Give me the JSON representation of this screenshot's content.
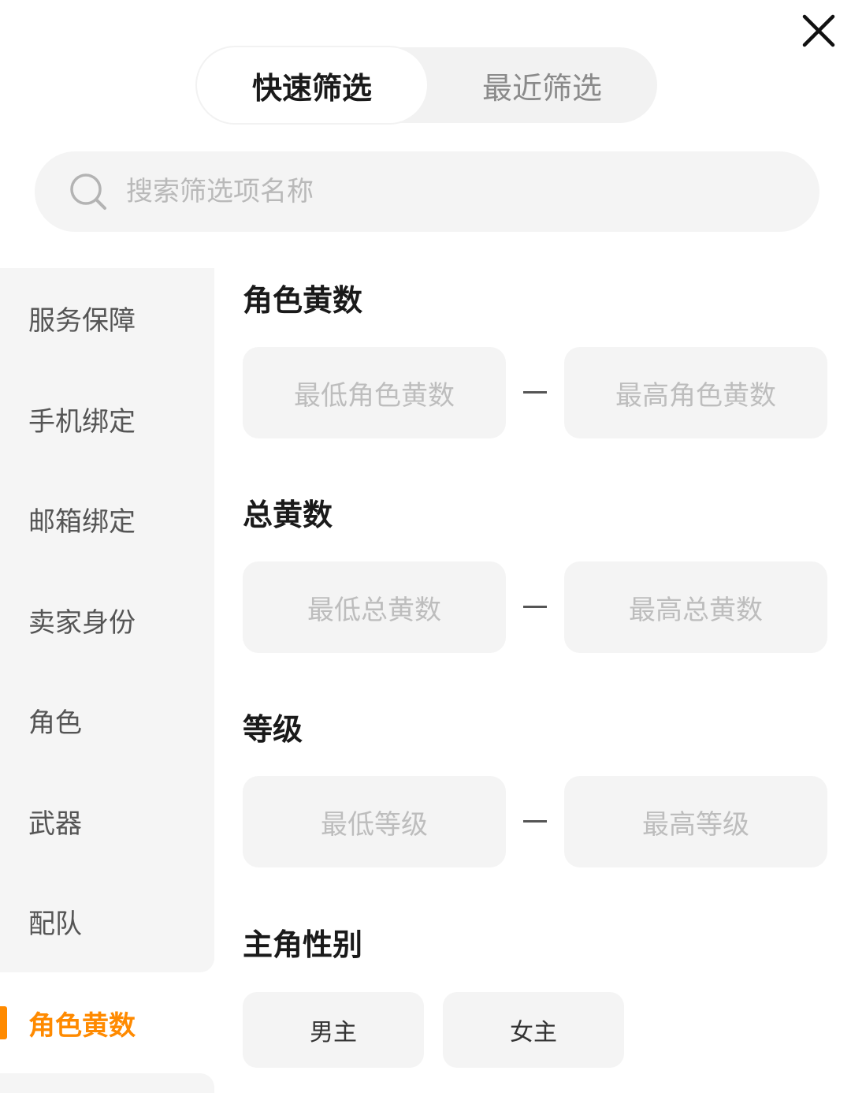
{
  "header": {
    "tabs": [
      {
        "label": "快速筛选",
        "active": true
      },
      {
        "label": "最近筛选",
        "active": false
      }
    ],
    "close_icon": "close-icon"
  },
  "search": {
    "placeholder": "搜索筛选项名称",
    "icon": "search-icon"
  },
  "sidebar": {
    "items": [
      {
        "label": "服务保障"
      },
      {
        "label": "手机绑定"
      },
      {
        "label": "邮箱绑定"
      },
      {
        "label": "卖家身份"
      },
      {
        "label": "角色"
      },
      {
        "label": "武器"
      },
      {
        "label": "配队"
      }
    ],
    "active_item": {
      "label": "角色黄数"
    },
    "accent_color": "#ff8a00"
  },
  "sections": {
    "role_gold": {
      "title": "角色黄数",
      "min_placeholder": "最低角色黄数",
      "max_placeholder": "最高角色黄数"
    },
    "total_gold": {
      "title": "总黄数",
      "min_placeholder": "最低总黄数",
      "max_placeholder": "最高总黄数"
    },
    "level": {
      "title": "等级",
      "min_placeholder": "最低等级",
      "max_placeholder": "最高等级"
    },
    "gender": {
      "title": "主角性别",
      "options": [
        {
          "label": "男主"
        },
        {
          "label": "女主"
        }
      ]
    }
  }
}
